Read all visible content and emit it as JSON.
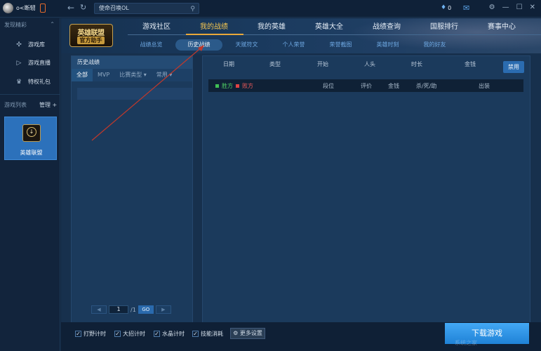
{
  "topbar": {
    "username": "o<断轫",
    "search_text": "使命召唤OL",
    "coins": "0",
    "window_buttons": [
      "⚙",
      "—",
      "☐",
      "✕"
    ]
  },
  "sidebar": {
    "section_featured": "发现精彩",
    "items": [
      {
        "label": "游戏库",
        "icon": "joystick-icon"
      },
      {
        "label": "游戏直播",
        "icon": "play-icon"
      },
      {
        "label": "特权礼包",
        "icon": "gift-icon"
      }
    ],
    "section_games": "游戏列表",
    "manage_label": "管理 +",
    "game_tile": "英雄联盟"
  },
  "header": {
    "logo_line1": "英雄联盟",
    "logo_line2": "官方助手",
    "tabs": [
      "游戏社区",
      "我的战绩",
      "我的英雄",
      "英雄大全",
      "战绩查询",
      "国服排行",
      "赛事中心"
    ],
    "active_tab": "我的战绩",
    "subtabs": [
      "战绩总览",
      "历史战绩",
      "天赋符文",
      "个人荣誉",
      "荣誉截图",
      "英雄时刻",
      "我的好友"
    ],
    "active_subtab": "历史战绩"
  },
  "history": {
    "title": "历史战绩",
    "filters": [
      "全部",
      "MVP",
      "比赛类型 ▾",
      "常用 ▾"
    ],
    "active_filter": "全部",
    "pager": {
      "prev": "◀",
      "page": "1",
      "total": "/1",
      "go": "GO",
      "next": "▶"
    }
  },
  "detail": {
    "columns": [
      "日期",
      "类型",
      "开始",
      "人头",
      "时长",
      "金钱"
    ],
    "forbid_button": "禁用",
    "legend_win": "胜方",
    "legend_loss": "败方",
    "sub_columns": [
      "段位",
      "评价",
      "金钱",
      "杀/死/助",
      "出装"
    ]
  },
  "bottom": {
    "checkboxes": [
      "打野计时",
      "大招计时",
      "水晶计时",
      "技能消耗"
    ],
    "more_settings": "更多设置",
    "download": "下载游戏"
  },
  "watermark": "系统之家",
  "colors": {
    "accent": "#f3c550",
    "brand_blue": "#2b6cb0",
    "win": "#3fbf54",
    "loss": "#e04444"
  }
}
